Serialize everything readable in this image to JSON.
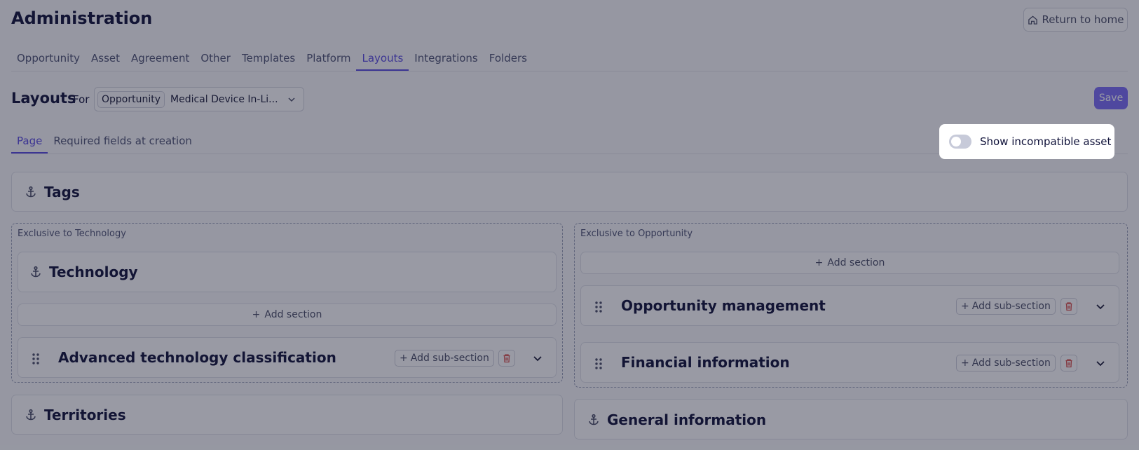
{
  "header": {
    "title": "Administration",
    "return_home": "Return to home"
  },
  "tabs": [
    {
      "label": "Opportunity"
    },
    {
      "label": "Asset"
    },
    {
      "label": "Agreement"
    },
    {
      "label": "Other"
    },
    {
      "label": "Templates"
    },
    {
      "label": "Platform"
    },
    {
      "label": "Layouts"
    },
    {
      "label": "Integrations"
    },
    {
      "label": "Folders"
    }
  ],
  "layouts": {
    "title": "Layouts",
    "for_label": "For",
    "select_chip": "Opportunity",
    "select_value": "Medical Device In-Li...",
    "save": "Save"
  },
  "subtabs": [
    {
      "label": "Page"
    },
    {
      "label": "Required fields at creation"
    }
  ],
  "toggle": {
    "label": "Show incompatible asset",
    "on": false
  },
  "sections": {
    "tags": "Tags",
    "territories": "Territories",
    "general": "General information",
    "left_group": {
      "label": "Exclusive to Technology",
      "technology": "Technology",
      "add_section": "Add section",
      "advanced": "Advanced technology classification",
      "add_sub": "Add sub-section"
    },
    "right_group": {
      "label": "Exclusive to Opportunity",
      "add_section": "Add section",
      "opp_mgmt": "Opportunity management",
      "financial": "Financial information",
      "add_sub": "Add sub-section"
    }
  },
  "colors": {
    "accent": "#5a4be0",
    "save_bg": "#7b6ef6",
    "overlay": "rgba(22,26,48,0.44)"
  }
}
